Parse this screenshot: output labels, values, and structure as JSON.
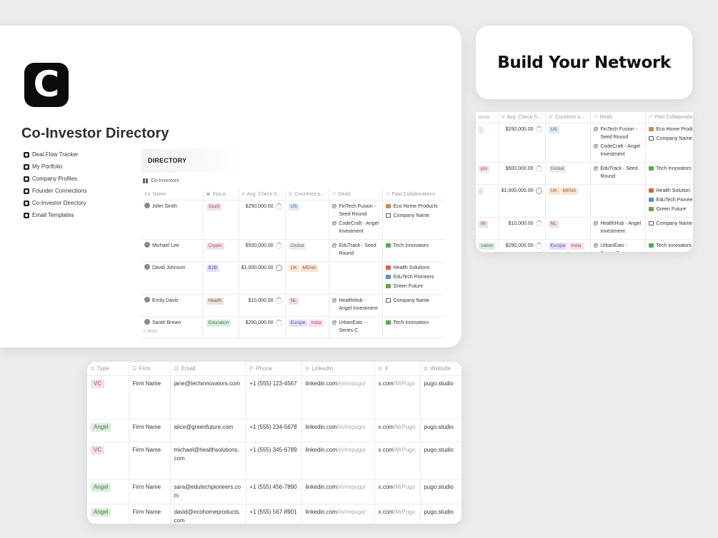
{
  "logo_letter": "C",
  "page_title": "Co-Investor Directory",
  "sidebar": {
    "items": [
      {
        "label": "Deal Flow Tracker"
      },
      {
        "label": "My Portfolio"
      },
      {
        "label": "Company Profiles"
      },
      {
        "label": "Founder Connections"
      },
      {
        "label": "Co-Investor Directory"
      },
      {
        "label": "Email Templates"
      }
    ]
  },
  "directory": {
    "heading": "DIRECTORY",
    "view_tab": "Co-Investors",
    "columns": {
      "name": "Name",
      "focus": "Focus",
      "avg_check": "Avg. Check-S...",
      "countries": "Countries o...",
      "deals": "Deals",
      "past_collab": "Past Collaborations"
    },
    "new_row": "New",
    "rows": [
      {
        "name": "John Smith",
        "focus": "SaaS",
        "focus_color": "#f5e0e9",
        "amount": "$250,000.00",
        "countries": [
          "US"
        ],
        "deals": [
          "FinTech Fusion - Seed Round",
          "CodeCraft - Angel Investment"
        ],
        "collabs": [
          "Eco Home Products",
          "Company Name"
        ]
      },
      {
        "name": "Michael Lee",
        "focus": "Crypto",
        "focus_color": "#f5e0e9",
        "amount": "$500,000.00",
        "countries": [
          "Global"
        ],
        "deals": [
          "EduTrack - Seed Round"
        ],
        "collabs": [
          "Tech Innovators"
        ]
      },
      {
        "name": "David Johnson",
        "focus": "B2B",
        "focus_color": "#e8defa",
        "amount": "$1,000,000.00",
        "countries": [
          "UK",
          "MENA"
        ],
        "deals": [],
        "collabs": [
          "Health Solutions",
          "EduTech Pioneers",
          "Green Future"
        ]
      },
      {
        "name": "Emily Davis",
        "focus": "Health",
        "focus_color": "#eee0da",
        "amount": "$10,000.00",
        "countries": [
          "NL"
        ],
        "deals": [
          "HealthHub - Angel Investment"
        ],
        "collabs": [
          "Company Name"
        ]
      },
      {
        "name": "Sarah Brown",
        "focus": "Education",
        "focus_color": "#dbeddb",
        "amount": "$290,000.00",
        "countries": [
          "Europe",
          "India"
        ],
        "deals": [
          "UrbanEats - Series C"
        ],
        "collabs": [
          "Tech Innovators"
        ]
      }
    ]
  },
  "network": {
    "heading": "Build Your Network",
    "columns": {
      "focus": "ocus",
      "avg_check": "Avg. Check-S...",
      "countries": "Countries o...",
      "deals": "Deals",
      "past_collab": "Past Collaboratio"
    },
    "rows": [
      {
        "focus": "",
        "amount": "$250,000.00",
        "countries": [
          "US"
        ],
        "deals": [
          "FinTech Fusion - Seed Round",
          "CodeCraft - Angel Investment"
        ],
        "collabs": [
          "Eco Home Produ",
          "Company Name"
        ]
      },
      {
        "focus": "pto",
        "amount": "$500,000.00",
        "countries": [
          "Global"
        ],
        "deals": [
          "EduTrack - Seed Round"
        ],
        "collabs": [
          "Tech Innovators"
        ]
      },
      {
        "focus": "",
        "amount": "$1,000,000.00",
        "countries": [
          "UK",
          "MENA"
        ],
        "deals": [],
        "collabs": [
          "Health Solution",
          "EduTech Pioneer",
          "Green Future"
        ]
      },
      {
        "focus": "lth",
        "amount": "$10,000.00",
        "countries": [
          "NL"
        ],
        "deals": [
          "HealthHub - Angel Investment"
        ],
        "collabs": [
          "Company Name"
        ]
      },
      {
        "focus": "cation",
        "amount": "$290,000.00",
        "countries": [
          "Europe",
          "India"
        ],
        "deals": [
          "UrbanEats - Series C"
        ],
        "collabs": [
          "Tech Innovators"
        ]
      }
    ]
  },
  "contacts": {
    "columns": {
      "type": "Type",
      "firm": "Firm",
      "email": "Email",
      "phone": "Phone",
      "linkedin": "LinkedIn",
      "x": "X",
      "website": "Website"
    },
    "rows": [
      {
        "type": "VC",
        "firm": "Firm Name",
        "email": "jane@techinnovators.com",
        "phone": "+1 (555) 123-4567",
        "li_a": "linkedin.com",
        "li_b": "/in/mrpugo/",
        "x_a": "x.com",
        "x_b": "/MrPugo",
        "web": "pugo.studio"
      },
      {
        "type": "Angel",
        "firm": "Firm Name",
        "email": "alice@greenfuture.com",
        "phone": "+1 (555) 234-5678",
        "li_a": "linkedin.com",
        "li_b": "/in/mrpugo/",
        "x_a": "x.com",
        "x_b": "/MrPugo",
        "web": "pugo.studio"
      },
      {
        "type": "VC",
        "firm": "Firm Name",
        "email": "michael@healthsolutions.com",
        "phone": "+1 (555) 345-6789",
        "li_a": "linkedin.com",
        "li_b": "/in/mrpugo/",
        "x_a": "x.com",
        "x_b": "/MrPugo",
        "web": "pugo.studio"
      },
      {
        "type": "Angel",
        "firm": "Firm Name",
        "email": "sara@edutechpioneers.com",
        "phone": "+1 (555) 456-7890",
        "li_a": "linkedin.com",
        "li_b": "/in/mrpugo/",
        "x_a": "x.com",
        "x_b": "/MrPugo",
        "web": "pugo.studio"
      },
      {
        "type": "Angel",
        "firm": "Firm Name",
        "email": "david@ecohomeproducts.com",
        "phone": "+1 (555) 567-8901",
        "li_a": "linkedin.com",
        "li_b": "/in/mrpugo/",
        "x_a": "x.com",
        "x_b": "/MrPugo",
        "web": "pugo.studio"
      }
    ]
  },
  "colors": {
    "vc_tag": "#f5e0e9",
    "angel_tag": "#dbeddb",
    "logo_bg": "#0b0b0b"
  }
}
